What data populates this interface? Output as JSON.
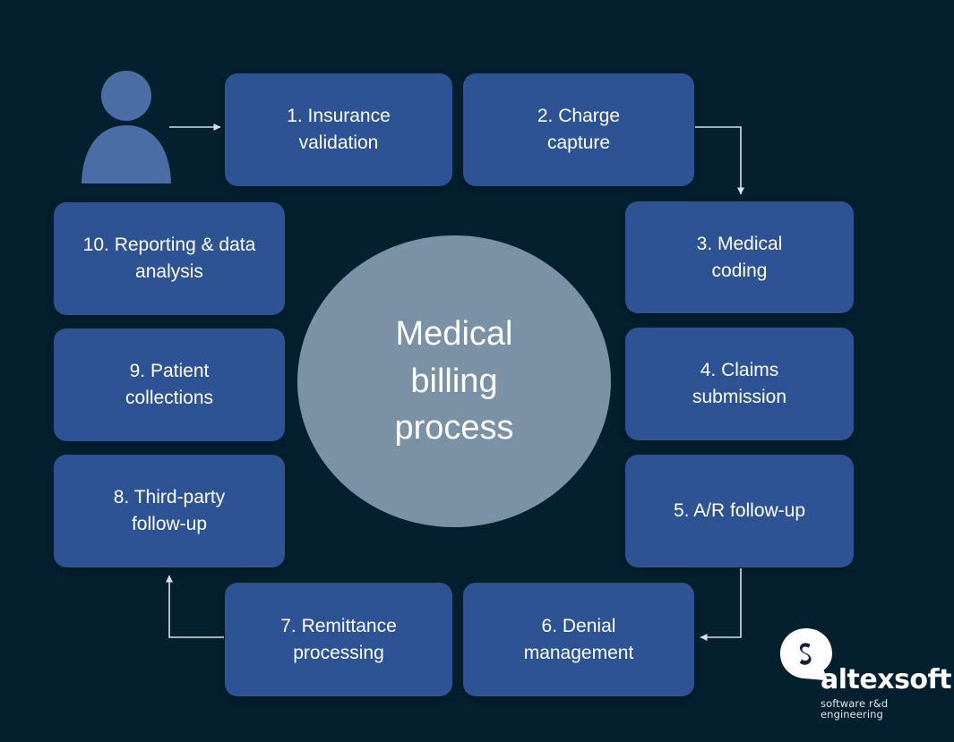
{
  "diagram": {
    "title": "Medical billing process",
    "center_label": "Medical\nbilling\nprocess",
    "background_color": "#04202f",
    "box_color": "#2d5394",
    "circle_color": "#7b91a6",
    "person_color": "#4a6da6",
    "text_color": "#ffffff",
    "connector_color": "#d8e0e6"
  },
  "actor": {
    "name": "person-icon"
  },
  "steps": [
    {
      "number": "1",
      "label": "1. Insurance\nvalidation",
      "id": "box-1"
    },
    {
      "number": "2",
      "label": "2. Charge\ncapture",
      "id": "box-2"
    },
    {
      "number": "3",
      "label": "3. Medical\ncoding",
      "id": "box-3"
    },
    {
      "number": "4",
      "label": "4. Claims\nsubmission",
      "id": "box-4"
    },
    {
      "number": "5",
      "label": "5. A/R follow-up",
      "id": "box-5"
    },
    {
      "number": "6",
      "label": "6. Denial\nmanagement",
      "id": "box-6"
    },
    {
      "number": "7",
      "label": "7. Remittance\nprocessing",
      "id": "box-7"
    },
    {
      "number": "8",
      "label": "8. Third-party\nfollow-up",
      "id": "box-8"
    },
    {
      "number": "9",
      "label": "9. Patient\ncollections",
      "id": "box-9"
    },
    {
      "number": "10",
      "label": "10. Reporting & data\nanalysis",
      "id": "box-10"
    }
  ],
  "connectors": [
    {
      "name": "arrow-person-to-step1",
      "from": "person-icon",
      "to": "1"
    },
    {
      "name": "arrow-step2-to-step3",
      "from": "2",
      "to": "3"
    },
    {
      "name": "arrow-step5-to-step6",
      "from": "5",
      "to": "6"
    },
    {
      "name": "arrow-step7-to-step8",
      "from": "7",
      "to": "8"
    }
  ],
  "logo": {
    "wordmark": "altexsoft",
    "tagline": "software r&d engineering",
    "mark_name": "altexsoft-speech-bubble-icon"
  }
}
